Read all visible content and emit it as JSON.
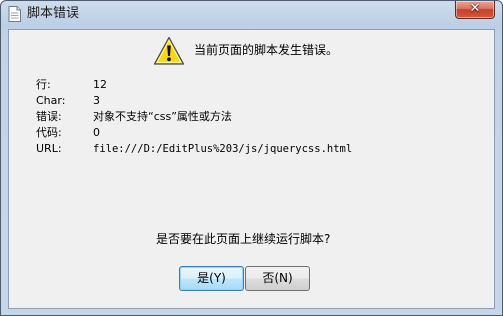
{
  "window": {
    "title": "脚本错误",
    "close_symbol": "✕",
    "title_icon": "document-icon",
    "close_icon": "close-icon"
  },
  "dialog": {
    "icon": "warning-icon",
    "message": "当前页面的脚本发生错误。",
    "details": [
      {
        "label": "行:",
        "value": "12"
      },
      {
        "label": "Char:",
        "value": "3"
      },
      {
        "label": "错误:",
        "value": "对象不支持“css”属性或方法"
      },
      {
        "label": "代码:",
        "value": "0"
      },
      {
        "label": "URL:",
        "value": "file:///D:/EditPlus%203/js/jquerycss.html"
      }
    ],
    "question": "是否要在此页面上继续运行脚本?",
    "buttons": {
      "yes": "是(Y)",
      "no": "否(N)"
    }
  },
  "colors": {
    "warning_fill": "#f8d816",
    "close_button": "#c94a33",
    "default_button_border": "#3c7fb1"
  }
}
